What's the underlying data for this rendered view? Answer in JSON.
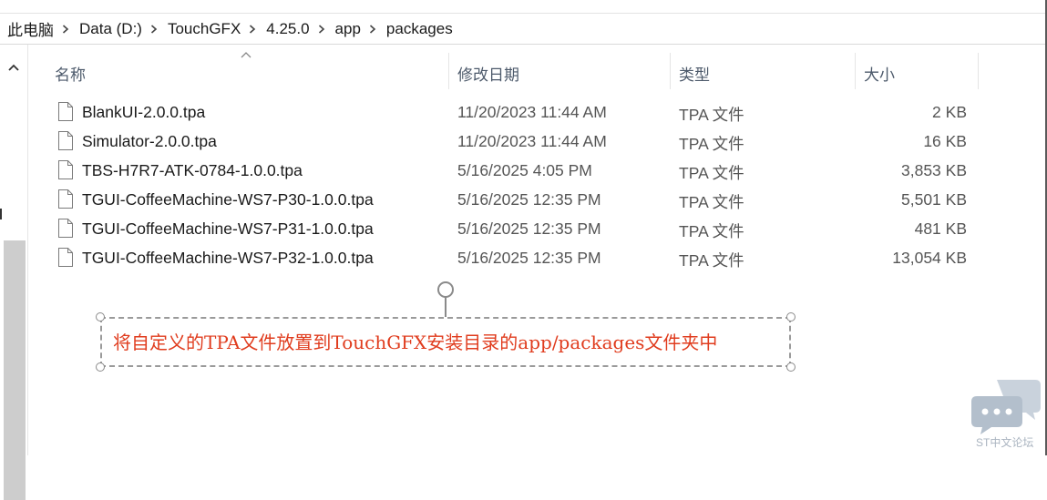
{
  "breadcrumb": [
    "此电脑",
    "Data (D:)",
    "TouchGFX",
    "4.25.0",
    "app",
    "packages"
  ],
  "columns": {
    "name": "名称",
    "date": "修改日期",
    "type": "类型",
    "size": "大小"
  },
  "files": [
    {
      "name": "BlankUI-2.0.0.tpa",
      "date": "11/20/2023 11:44 AM",
      "type": "TPA 文件",
      "size": "2 KB"
    },
    {
      "name": "Simulator-2.0.0.tpa",
      "date": "11/20/2023 11:44 AM",
      "type": "TPA 文件",
      "size": "16 KB"
    },
    {
      "name": "TBS-H7R7-ATK-0784-1.0.0.tpa",
      "date": "5/16/2025 4:05 PM",
      "type": "TPA 文件",
      "size": "3,853 KB"
    },
    {
      "name": "TGUI-CoffeeMachine-WS7-P30-1.0.0.tpa",
      "date": "5/16/2025 12:35 PM",
      "type": "TPA 文件",
      "size": "5,501 KB"
    },
    {
      "name": "TGUI-CoffeeMachine-WS7-P31-1.0.0.tpa",
      "date": "5/16/2025 12:35 PM",
      "type": "TPA 文件",
      "size": "481 KB"
    },
    {
      "name": "TGUI-CoffeeMachine-WS7-P32-1.0.0.tpa",
      "date": "5/16/2025 12:35 PM",
      "type": "TPA 文件",
      "size": "13,054 KB"
    }
  ],
  "annotation": {
    "text": "将自定义的TPA文件放置到TouchGFX安装目录的app/packages文件夹中"
  },
  "watermark": {
    "text": "ST中文论坛"
  },
  "colors": {
    "annotation_text": "#e03c1e",
    "header_text": "#4d5a6b"
  }
}
